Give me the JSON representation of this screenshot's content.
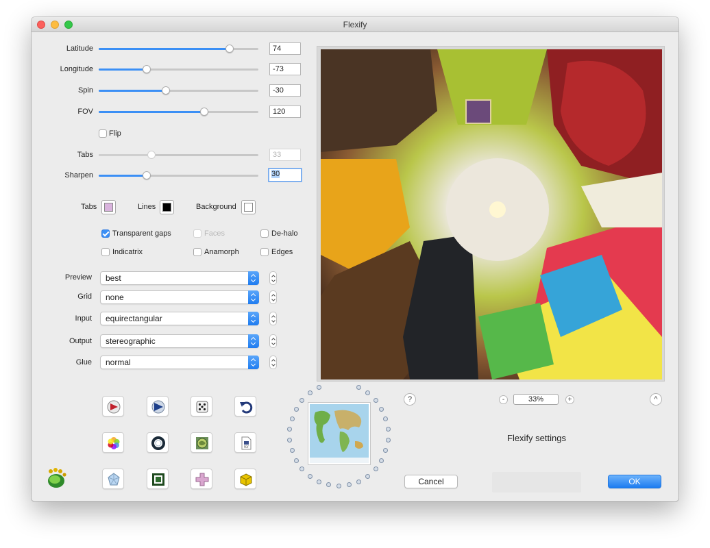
{
  "window": {
    "title": "Flexify"
  },
  "sliders": [
    {
      "key": "latitude",
      "label": "Latitude",
      "value": "74",
      "fraction": 0.82,
      "disabled": false,
      "focused": false
    },
    {
      "key": "longitude",
      "label": "Longitude",
      "value": "-73",
      "fraction": 0.3,
      "disabled": false,
      "focused": false
    },
    {
      "key": "spin",
      "label": "Spin",
      "value": "-30",
      "fraction": 0.42,
      "disabled": false,
      "focused": false
    },
    {
      "key": "fov",
      "label": "FOV",
      "value": "120",
      "fraction": 0.66,
      "disabled": false,
      "focused": false
    },
    {
      "key": "tabs",
      "label": "Tabs",
      "value": "33",
      "fraction": 0.33,
      "disabled": true,
      "focused": false
    },
    {
      "key": "sharpen",
      "label": "Sharpen",
      "value": "30",
      "fraction": 0.3,
      "disabled": false,
      "focused": true
    }
  ],
  "flip": {
    "label": "Flip",
    "checked": false
  },
  "colors": {
    "tabs": {
      "label": "Tabs",
      "color": "#d9b3dd"
    },
    "lines": {
      "label": "Lines",
      "color": "#000000"
    },
    "background": {
      "label": "Background",
      "color": "#ffffff"
    }
  },
  "options": {
    "transparent_gaps": {
      "label": "Transparent gaps",
      "checked": true,
      "disabled": false
    },
    "faces": {
      "label": "Faces",
      "checked": false,
      "disabled": true
    },
    "de_halo": {
      "label": "De-halo",
      "checked": false,
      "disabled": false
    },
    "indicatrix": {
      "label": "Indicatrix",
      "checked": false,
      "disabled": false
    },
    "anamorph": {
      "label": "Anamorph",
      "checked": false,
      "disabled": false
    },
    "edges": {
      "label": "Edges",
      "checked": false,
      "disabled": false
    }
  },
  "selects": {
    "preview": {
      "label": "Preview",
      "value": "best"
    },
    "grid": {
      "label": "Grid",
      "value": "none"
    },
    "input": {
      "label": "Input",
      "value": "equirectangular"
    },
    "output": {
      "label": "Output",
      "value": "stereographic"
    },
    "glue": {
      "label": "Glue",
      "value": "normal"
    }
  },
  "toolbar_icons": [
    "export-icon",
    "play-icon",
    "dice-icon",
    "undo-icon",
    "color-wheel-icon",
    "ring-icon",
    "globe-icon",
    "pdf-icon",
    "polyhedron-icon",
    "frame-icon",
    "cross-net-icon",
    "cube-icon"
  ],
  "footer": {
    "zoom": "33%",
    "zoom_minus": "-",
    "zoom_plus": "+",
    "help": "?",
    "collapse": "^",
    "settings_title": "Flexify settings",
    "cancel_label": "Cancel",
    "ok_label": "OK"
  },
  "accent_color": "#3b8ff5"
}
